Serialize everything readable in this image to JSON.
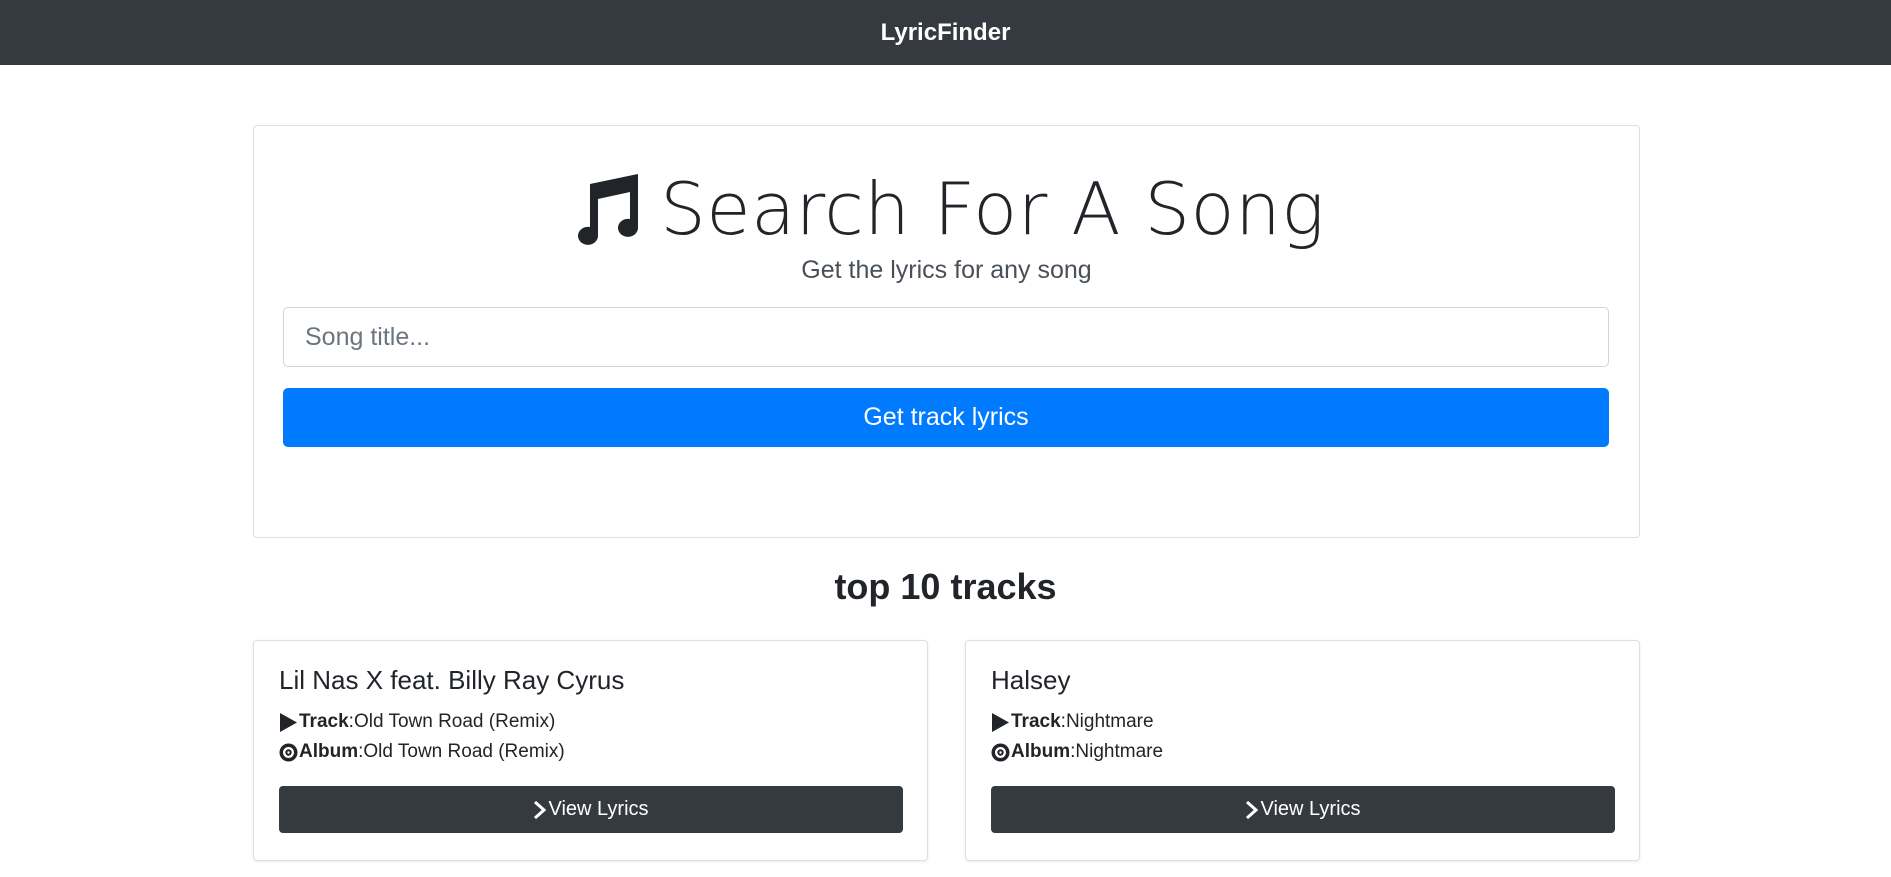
{
  "navbar": {
    "brand": "LyricFinder"
  },
  "search": {
    "title": "Search For A Song",
    "subtitle": "Get the lyrics for any song",
    "input_placeholder": "Song title...",
    "input_value": "",
    "button_label": "Get track lyrics",
    "title_icon": "music-note-icon"
  },
  "tracks_section": {
    "heading": "top 10 tracks",
    "track_label": "Track",
    "album_label": "Album",
    "separator": ":",
    "view_button_label": "View Lyrics",
    "items": [
      {
        "artist": "Lil Nas X feat. Billy Ray Cyrus",
        "track": "Old Town Road (Remix)",
        "album": "Old Town Road (Remix)"
      },
      {
        "artist": "Halsey",
        "track": "Nightmare",
        "album": "Nightmare"
      }
    ]
  },
  "colors": {
    "navbar_bg": "#343a40",
    "primary": "#007bff",
    "dark_button": "#343a40"
  }
}
